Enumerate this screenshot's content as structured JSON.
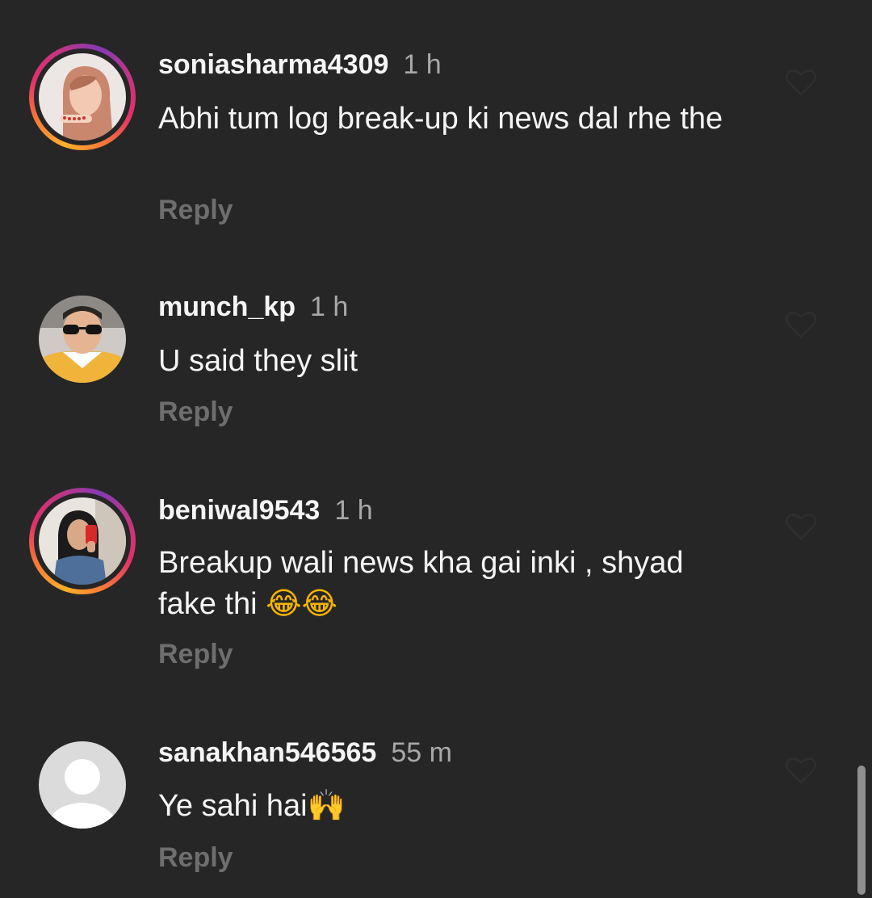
{
  "comments": [
    {
      "username": "soniasharma4309",
      "time": "1 h",
      "text": "Abhi tum log break-up ki news dal rhe the",
      "reply": "Reply",
      "avatar": "avatar-woman-icon",
      "story_ring": true
    },
    {
      "username": "munch_kp",
      "time": "1 h",
      "text": "U said they slit",
      "reply": "Reply",
      "avatar": "avatar-man-sunglasses-icon",
      "story_ring": false
    },
    {
      "username": "beniwal9543",
      "time": "1 h",
      "text": "Breakup wali news kha gai inki , shyad fake thi",
      "emoji": "😂😂",
      "reply": "Reply",
      "avatar": "avatar-woman-selfie-icon",
      "story_ring": true
    },
    {
      "username": "sanakhan546565",
      "time": "55 m",
      "text": "Ye sahi hai",
      "emoji": "🙌",
      "reply": "Reply",
      "avatar": "default-avatar-icon",
      "story_ring": false
    }
  ],
  "colors": {
    "background": "#262626",
    "text": "#f5f5f5",
    "muted": "#a8a8a8",
    "reply": "#6e6e6e"
  }
}
